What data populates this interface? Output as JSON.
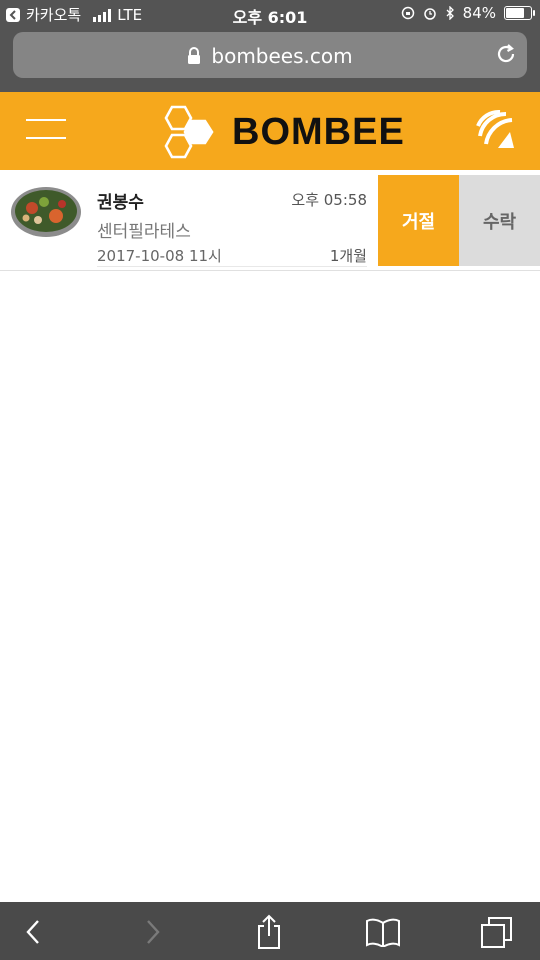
{
  "status_bar": {
    "back_app": "카카오톡",
    "network": "LTE",
    "time": "오후 6:01",
    "battery": "84%",
    "battery_level": 0.84
  },
  "browser": {
    "url": "bombees.com"
  },
  "header": {
    "logo_text": "BOMBEE",
    "accent_color": "#f6a81c"
  },
  "requests": [
    {
      "name": "권봉수",
      "time": "오후 05:58",
      "place": "센터필라테스",
      "date": "2017-10-08 11시",
      "duration": "1개월",
      "reject_label": "거절",
      "accept_label": "수락"
    }
  ],
  "icons": {
    "menu": "hamburger-icon",
    "right": "signal-waves-icon",
    "toolbar": [
      "back-arrow-icon",
      "forward-arrow-icon",
      "share-icon",
      "bookmarks-icon",
      "tabs-icon"
    ]
  }
}
